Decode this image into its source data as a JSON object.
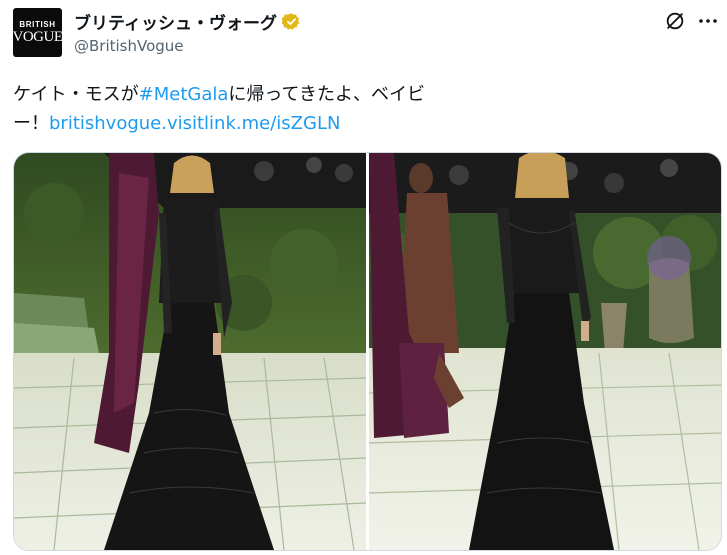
{
  "account": {
    "avatar_line1": "BRITISH",
    "avatar_line2": "VOGUE",
    "display_name": "ブリティッシュ・ヴォーグ",
    "handle": "@BritishVogue",
    "verified_badge_color": "#e2b719"
  },
  "actions": {
    "grok_icon": "grok-icon",
    "more_icon": "more-icon"
  },
  "tweet": {
    "text_part1": "ケイト・モスが",
    "hashtag": "#MetGala",
    "text_part2": "に帰ってきたよ、ベイビ",
    "text_part3": "ー！",
    "url": "britishvogue.visitlink.me/isZGLN",
    "link_color": "#1d9bf0"
  },
  "media": {
    "photos": [
      "photo-1",
      "photo-2"
    ]
  }
}
